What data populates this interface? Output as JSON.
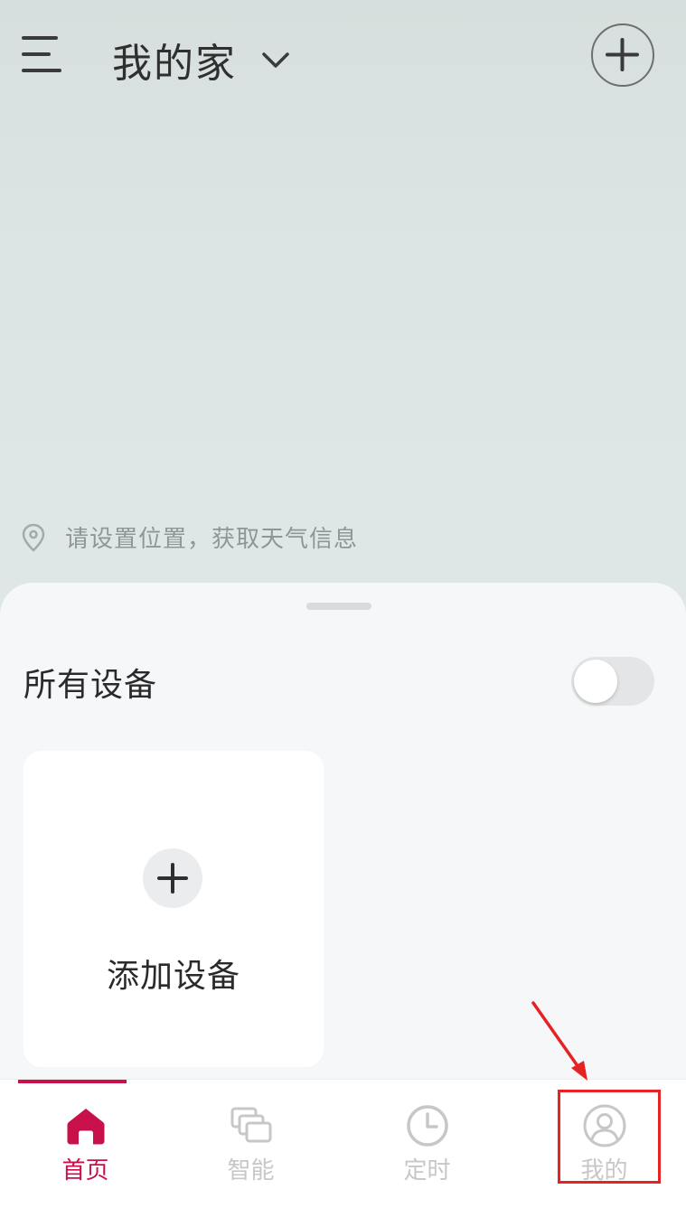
{
  "header": {
    "home_title": "我的家"
  },
  "weather": {
    "text": "请设置位置，获取天气信息"
  },
  "devices": {
    "section_title": "所有设备",
    "add_label": "添加设备"
  },
  "tabs": [
    {
      "label": "首页",
      "icon": "home-icon",
      "active": true
    },
    {
      "label": "智能",
      "icon": "smart-scenes-icon",
      "active": false
    },
    {
      "label": "定时",
      "icon": "clock-icon",
      "active": false
    },
    {
      "label": "我的",
      "icon": "profile-icon",
      "active": false
    }
  ],
  "colors": {
    "accent": "#c8114a",
    "inactive": "#c7c7c7",
    "annotation": "#e52224"
  }
}
